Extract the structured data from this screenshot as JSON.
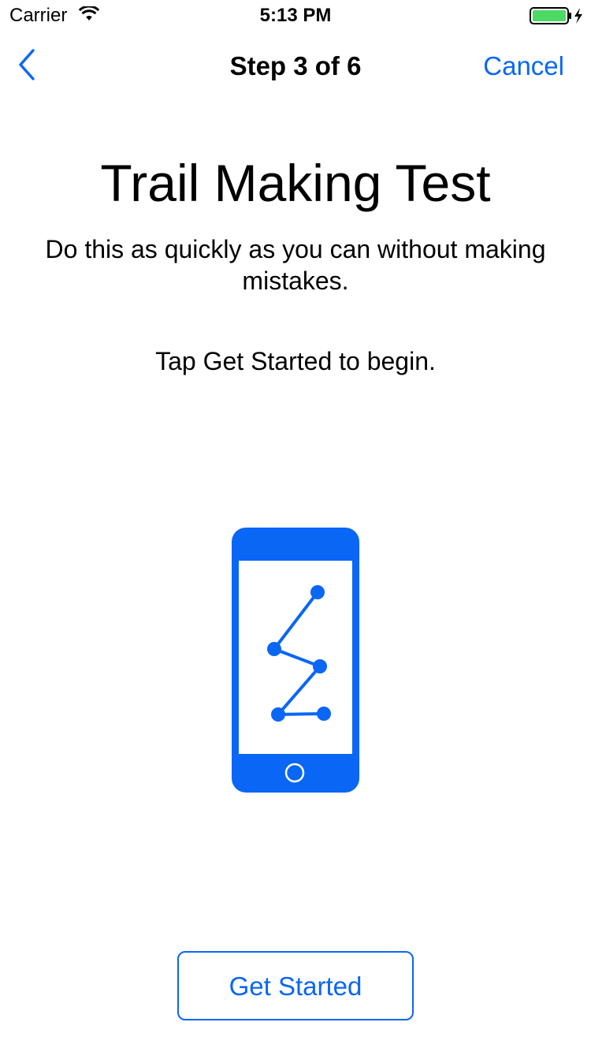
{
  "status_bar": {
    "carrier": "Carrier",
    "time": "5:13 PM",
    "wifi_icon": "wifi-icon",
    "battery_icon": "battery-charging-icon",
    "battery_color": "#4cd964"
  },
  "nav": {
    "back_icon": "chevron-left-icon",
    "title": "Step 3 of 6",
    "cancel_label": "Cancel"
  },
  "content": {
    "title": "Trail Making Test",
    "instructions": "Do this as quickly as you can without making mistakes.",
    "prompt": "Tap Get Started to begin.",
    "illustration_icon": "phone-trail-icon"
  },
  "actions": {
    "primary_label": "Get Started"
  },
  "colors": {
    "accent": "#0a66f5",
    "text": "#000000",
    "background": "#ffffff"
  }
}
